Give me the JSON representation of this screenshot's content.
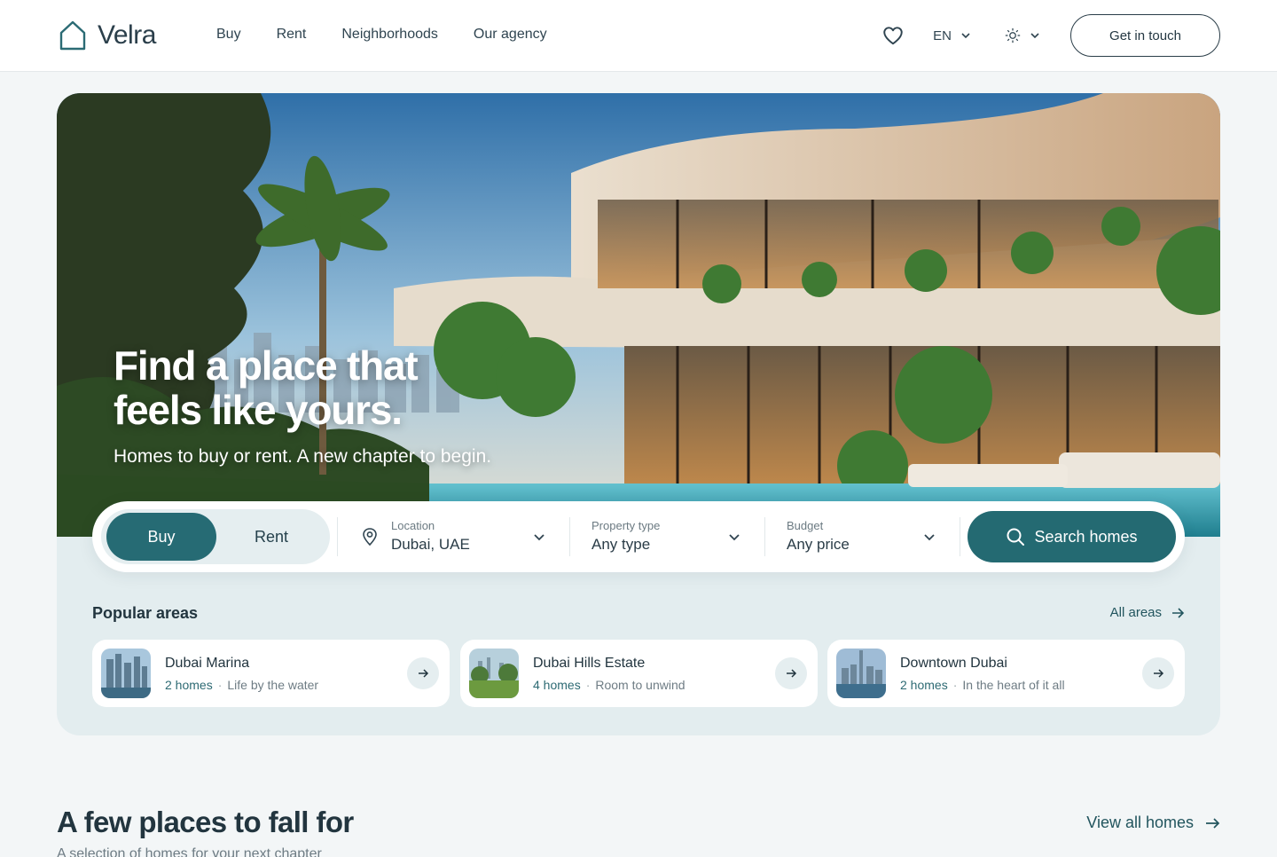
{
  "header": {
    "logo_text": "Velra",
    "nav": [
      "Buy",
      "Rent",
      "Neighborhoods",
      "Our agency"
    ],
    "language": "EN",
    "cta_label": "Get in touch"
  },
  "hero": {
    "title_line1": "Find a place that",
    "title_line2": "feels like yours.",
    "subtitle": "Homes to buy or rent. A new chapter to begin."
  },
  "search": {
    "mode_options": [
      "Buy",
      "Rent"
    ],
    "active_mode": "Buy",
    "location": {
      "label": "Location",
      "value": "Dubai, UAE"
    },
    "property_type": {
      "label": "Property type",
      "value": "Any type"
    },
    "budget": {
      "label": "Budget",
      "value": "Any price"
    },
    "button_label": "Search homes"
  },
  "popular_areas": {
    "title": "Popular areas",
    "all_link": "All areas",
    "items": [
      {
        "name": "Dubai Marina",
        "count": "2 homes",
        "tagline": "Life by the water"
      },
      {
        "name": "Dubai Hills Estate",
        "count": "4 homes",
        "tagline": "Room to unwind"
      },
      {
        "name": "Downtown Dubai",
        "count": "2 homes",
        "tagline": "In the heart of it all"
      }
    ]
  },
  "featured": {
    "title": "A few places to fall for",
    "subtitle": "A selection of homes for your next chapter",
    "view_all": "View all homes"
  },
  "colors": {
    "accent": "#266b74",
    "hero_panel": "#e3edef",
    "background": "#f3f6f7"
  }
}
